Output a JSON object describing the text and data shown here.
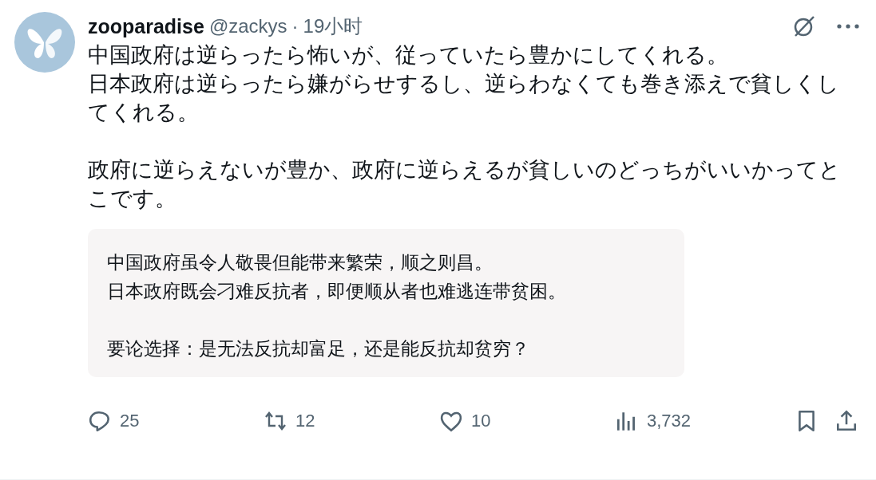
{
  "post": {
    "author_name": "zooparadise",
    "handle": "@zackys",
    "separator": "·",
    "time": "19小时",
    "paragraphs": [
      [
        "中国政府は逆らったら怖いが、従っていたら豊かにしてくれる。",
        "日本政府は逆らったら嫌がらせするし、逆らわなくても巻き添えで貧しくしてくれる。"
      ],
      [
        "政府に逆らえないが豊か、政府に逆らえるが貧しいのどっちがいいかってとこです。"
      ]
    ],
    "translation": [
      [
        "中国政府虽令人敬畏但能带来繁荣，顺之则昌。",
        "日本政府既会刁难反抗者，即便顺从者也难逃连带贫困。"
      ],
      [
        "要论选择：是无法反抗却富足，还是能反抗却贫穷？"
      ]
    ]
  },
  "actions": [
    {
      "kind": "reply",
      "count": "25"
    },
    {
      "kind": "repost",
      "count": "12"
    },
    {
      "kind": "like",
      "count": "10"
    },
    {
      "kind": "views",
      "count": "3,732"
    },
    {
      "kind": "bookmark"
    },
    {
      "kind": "share"
    }
  ]
}
